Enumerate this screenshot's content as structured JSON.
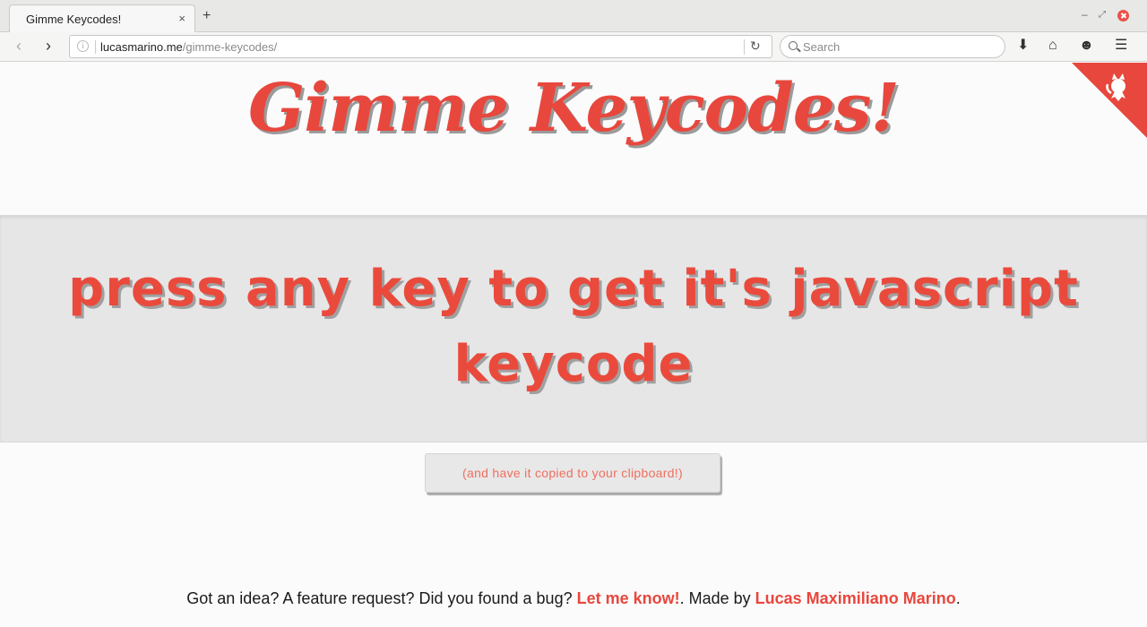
{
  "browser": {
    "tab_title": "Gimme Keycodes!",
    "tab_close": "×",
    "new_tab": "+",
    "url_host": "lucasmarino.me",
    "url_path": "/gimme-keycodes/",
    "search_placeholder": "Search"
  },
  "page": {
    "title": "Gimme Keycodes!",
    "banner_text": "press any key to get it's javascript keycode",
    "clipboard_button": "(and have it copied to your clipboard!)",
    "footer": {
      "prefix": "Got an idea? A feature request? Did you found a bug? ",
      "link1": "Let me know!",
      "middle": ". Made by ",
      "link2": "Lucas Maximiliano Marino",
      "suffix": "."
    }
  },
  "colors": {
    "accent": "#e8473d",
    "banner_bg": "#e6e6e6"
  },
  "icons": [
    "back-icon",
    "forward-icon",
    "info-icon",
    "reload-icon",
    "search-icon",
    "download-icon",
    "home-icon",
    "chat-icon",
    "menu-icon",
    "github-icon"
  ]
}
